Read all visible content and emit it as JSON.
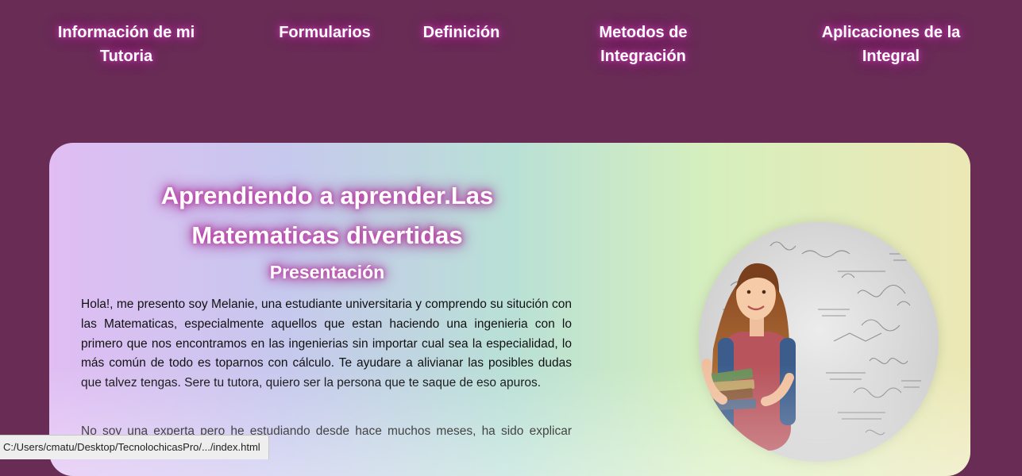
{
  "nav": {
    "items": [
      {
        "label": "Información de mi Tutoria"
      },
      {
        "label": "Formularios"
      },
      {
        "label": "Definición"
      },
      {
        "label": "Metodos de Integración"
      },
      {
        "label": "Aplicaciones de la Integral"
      }
    ]
  },
  "main": {
    "title": "Aprendiendo a aprender.Las Matematicas divertidas",
    "subtitle": "Presentación",
    "paragraphs": [
      "Hola!, me presento soy Melanie, una estudiante universitaria y comprendo su situción con las Matematicas, especialmente aquellos que estan haciendo una ingenieria con lo primero que nos encontramos en las ingenierias sin importar cual sea la especialidad, lo más común de todo es toparnos con cálculo. Te ayudare a alivianar las posibles dudas que talvez tengas. Sere tu tutora, quiero ser la persona que te saque de eso apuros.",
      "No soy una experta pero he estudiando desde hace muchos meses, ha sido explicar cosas algo complejas en"
    ],
    "photo_icon": "tutor-photo"
  },
  "status": {
    "url": "C:/Users/cmatu/Desktop/TecnolochicasPro/.../index.html"
  },
  "colors": {
    "page_background": "#682c55",
    "heading_glow": "#c03aa8"
  }
}
